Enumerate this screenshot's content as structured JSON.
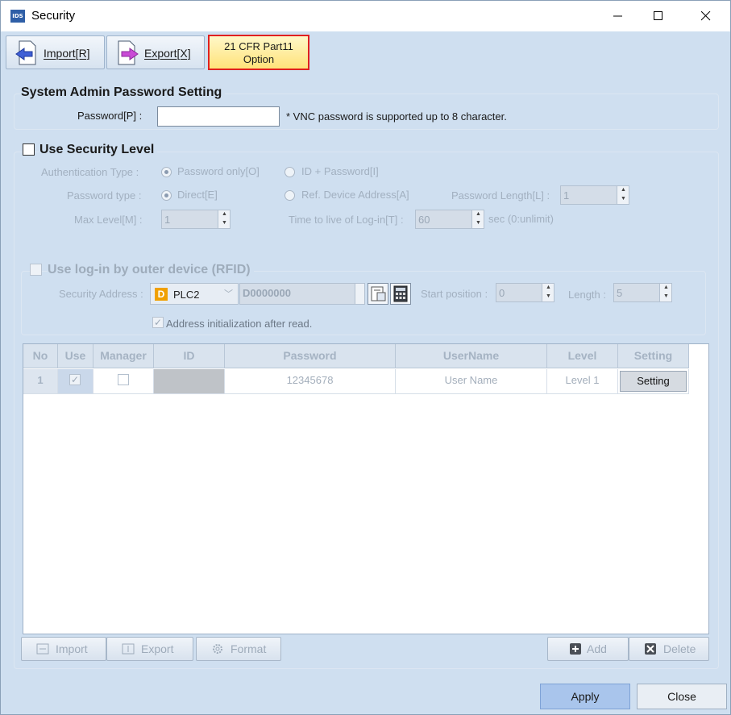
{
  "window": {
    "title": "Security",
    "app_icon": "IDS"
  },
  "toolbar": {
    "import_label": "Import[R]",
    "export_label": "Export[X]",
    "cfr_line1": "21 CFR Part11",
    "cfr_line2": "Option"
  },
  "admin": {
    "title": "System Admin Password Setting",
    "password_label": "Password[P] :",
    "password_value": "",
    "note": "* VNC password is supported up to 8 character."
  },
  "security": {
    "title": "Use Security Level",
    "checked": false,
    "auth_type_label": "Authentication Type :",
    "auth_option1": "Password only[O]",
    "auth_option2": "ID + Password[I]",
    "pw_type_label": "Password type :",
    "pw_type_option1": "Direct[E]",
    "pw_type_option2": "Ref. Device Address[A]",
    "pw_length_label": "Password Length[L] :",
    "pw_length_value": "1",
    "max_level_label": "Max Level[M] :",
    "max_level_value": "1",
    "ttl_label": "Time to live of Log-in[T] :",
    "ttl_value": "60",
    "ttl_unit": "sec (0:unlimit)"
  },
  "rfid": {
    "title": "Use log-in by outer device (RFID)",
    "sec_addr_label": "Security Address :",
    "device_badge": "D",
    "plc": "PLC2",
    "address": "D0000000",
    "start_label": "Start position :",
    "start_value": "0",
    "length_label": "Length :",
    "length_value": "5",
    "init_label": "Address initialization after read."
  },
  "grid": {
    "columns": [
      "No",
      "Use",
      "Manager",
      "ID",
      "Password",
      "UserName",
      "Level",
      "Setting"
    ],
    "row": {
      "no": "1",
      "password": "12345678",
      "username": "User Name",
      "level": "Level 1",
      "setting": "Setting"
    }
  },
  "grid_buttons": {
    "import": "Import",
    "export": "Export",
    "format": "Format",
    "add": "Add",
    "delete": "Delete"
  },
  "footer": {
    "apply": "Apply",
    "close": "Close"
  }
}
